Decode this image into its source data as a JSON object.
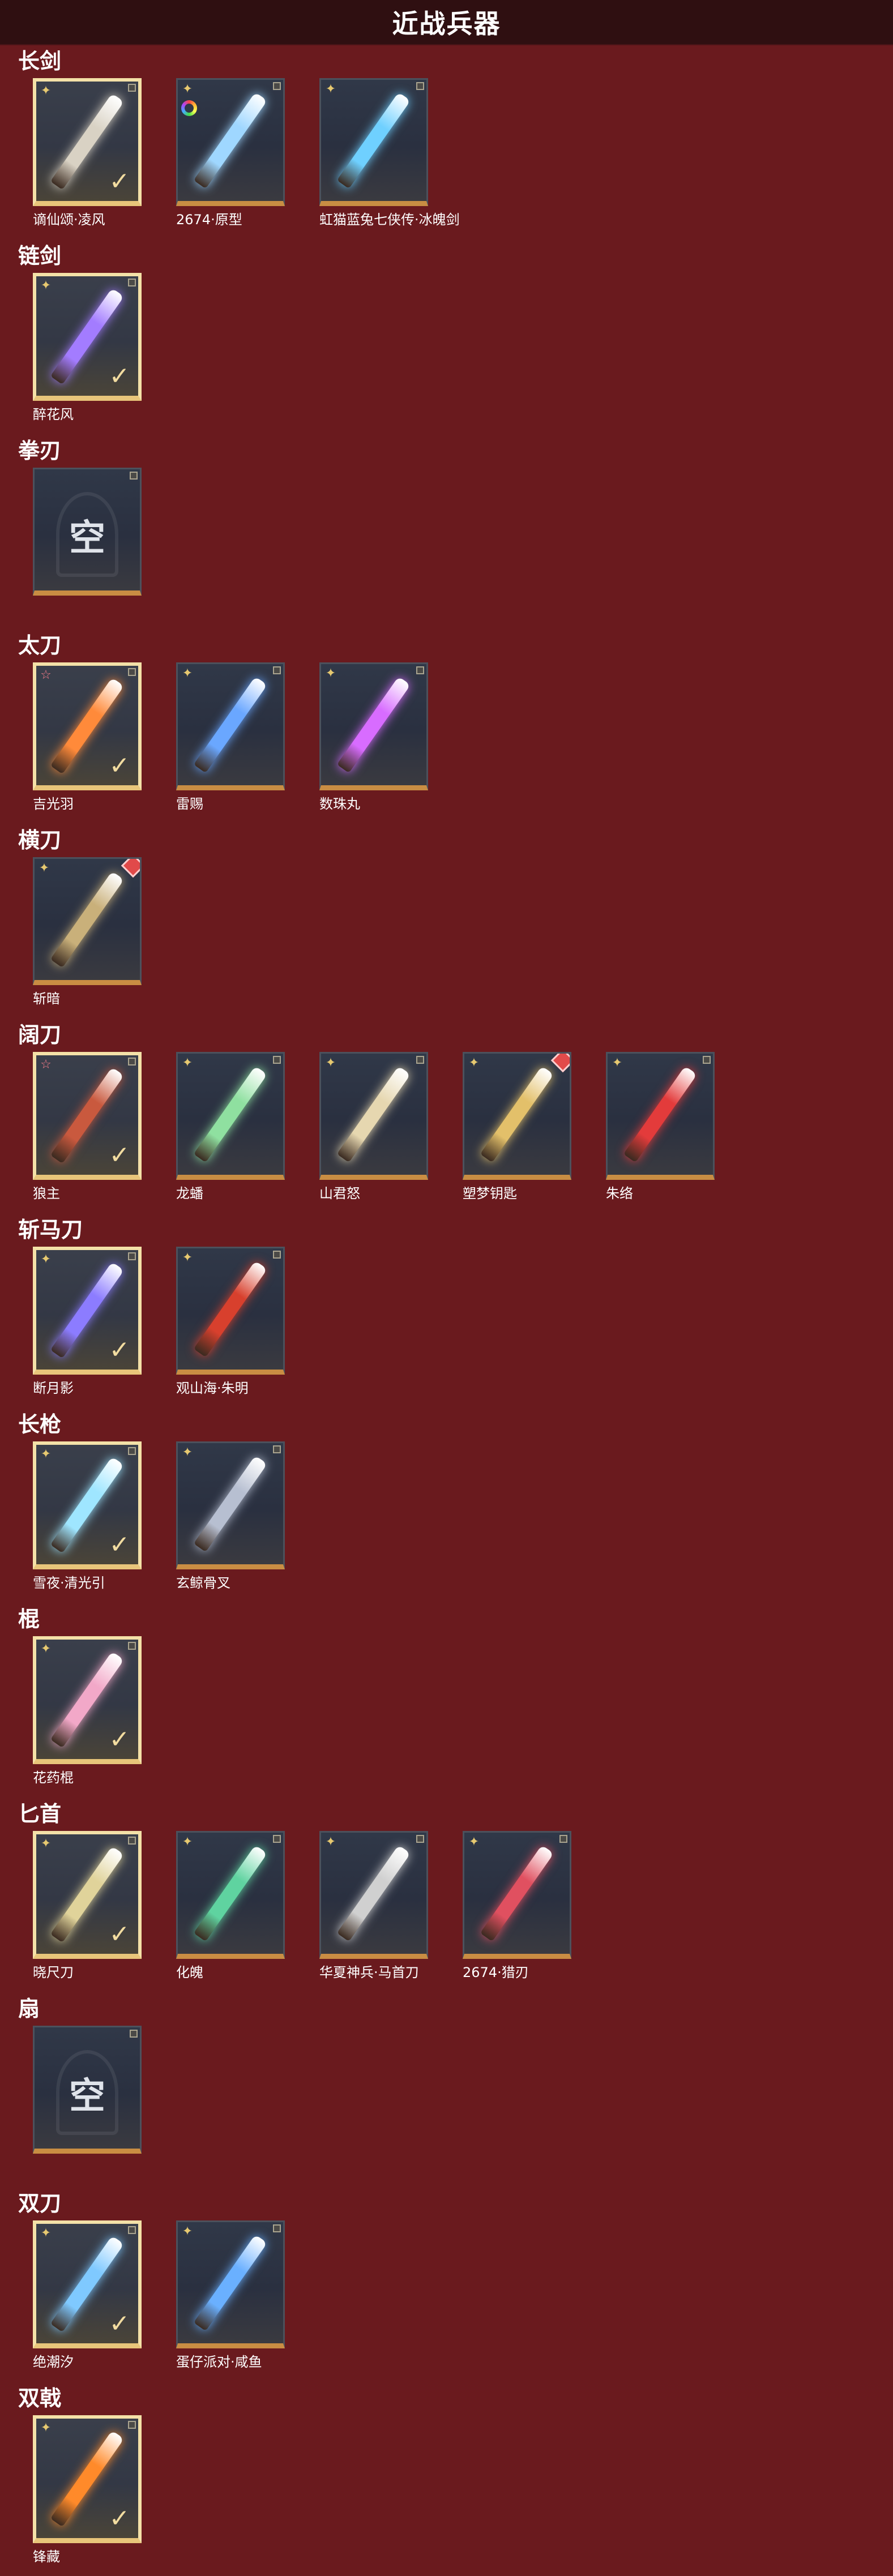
{
  "header": {
    "title": "近战兵器"
  },
  "icons": {
    "rank": "shuriken-star-icon",
    "check": "checkmark-icon"
  },
  "sections": [
    {
      "title": "长剑",
      "items": [
        {
          "name": "谪仙颂·凌风",
          "equipped": true,
          "rank": "gold",
          "color": "#d9d2c4"
        },
        {
          "name": "2674·原型",
          "equipped": false,
          "rank": "gold",
          "badge": "rainbow",
          "color": "#9fd7ff"
        },
        {
          "name": "虹猫蓝兔七侠传·冰魄剑",
          "equipped": false,
          "rank": "gold",
          "color": "#6fd0ff"
        }
      ]
    },
    {
      "title": "链剑",
      "items": [
        {
          "name": "醉花风",
          "equipped": true,
          "rank": "gold",
          "color": "#a37cff"
        }
      ]
    },
    {
      "title": "拳刃",
      "items": [
        {
          "name": "",
          "empty": true,
          "empty_text": "空"
        }
      ]
    },
    {
      "title": "太刀",
      "items": [
        {
          "name": "吉光羽",
          "equipped": true,
          "rank": "rare",
          "color": "#ff8a3a"
        },
        {
          "name": "雷赐",
          "equipped": false,
          "rank": "gold",
          "color": "#6aa7ff"
        },
        {
          "name": "数珠丸",
          "equipped": false,
          "rank": "gold",
          "color": "#d86cff"
        }
      ]
    },
    {
      "title": "横刀",
      "items": [
        {
          "name": "斩暗",
          "equipped": false,
          "rank": "gold",
          "badge": "diamond",
          "color": "#c9b07a"
        }
      ]
    },
    {
      "title": "阔刀",
      "items": [
        {
          "name": "狼主",
          "equipped": true,
          "rank": "rare",
          "color": "#c9593e"
        },
        {
          "name": "龙蟠",
          "equipped": false,
          "rank": "gold",
          "color": "#8fe0a0"
        },
        {
          "name": "山君怒",
          "equipped": false,
          "rank": "gold",
          "color": "#e6d7b0"
        },
        {
          "name": "塑梦钥匙",
          "equipped": false,
          "rank": "gold",
          "badge": "diamond",
          "color": "#e3c06a"
        },
        {
          "name": "朱络",
          "equipped": false,
          "rank": "gold",
          "color": "#e33b3b"
        }
      ]
    },
    {
      "title": "斩马刀",
      "items": [
        {
          "name": "断月影",
          "equipped": true,
          "rank": "gold",
          "color": "#8c7cff"
        },
        {
          "name": "观山海·朱明",
          "equipped": false,
          "rank": "gold",
          "color": "#d8402d"
        }
      ]
    },
    {
      "title": "长枪",
      "items": [
        {
          "name": "雪夜·清光引",
          "equipped": true,
          "rank": "gold",
          "color": "#9fe6ff"
        },
        {
          "name": "玄鲸骨叉",
          "equipped": false,
          "rank": "gold",
          "color": "#b7bfd1"
        }
      ]
    },
    {
      "title": "棍",
      "items": [
        {
          "name": "花药棍",
          "equipped": true,
          "rank": "gold",
          "color": "#f2a8c8"
        }
      ]
    },
    {
      "title": "匕首",
      "items": [
        {
          "name": "晓尺刀",
          "equipped": true,
          "rank": "gold",
          "color": "#e0d39a"
        },
        {
          "name": "化魄",
          "equipped": false,
          "rank": "gold",
          "color": "#5fd3a0"
        },
        {
          "name": "华夏神兵·马首刀",
          "equipped": false,
          "rank": "gold",
          "color": "#d0d0d0"
        },
        {
          "name": "2674·猎刃",
          "equipped": false,
          "rank": "gold",
          "color": "#e05060"
        }
      ]
    },
    {
      "title": "扇",
      "items": [
        {
          "name": "",
          "empty": true,
          "empty_text": "空"
        }
      ]
    },
    {
      "title": "双刀",
      "items": [
        {
          "name": "绝潮汐",
          "equipped": true,
          "rank": "gold",
          "color": "#7fc9ff"
        },
        {
          "name": "蛋仔派对·咸鱼",
          "equipped": false,
          "rank": "gold",
          "color": "#6ab0ff"
        }
      ]
    },
    {
      "title": "双戟",
      "items": [
        {
          "name": "锋藏",
          "equipped": true,
          "rank": "gold",
          "color": "#ff8a2a"
        }
      ]
    }
  ]
}
